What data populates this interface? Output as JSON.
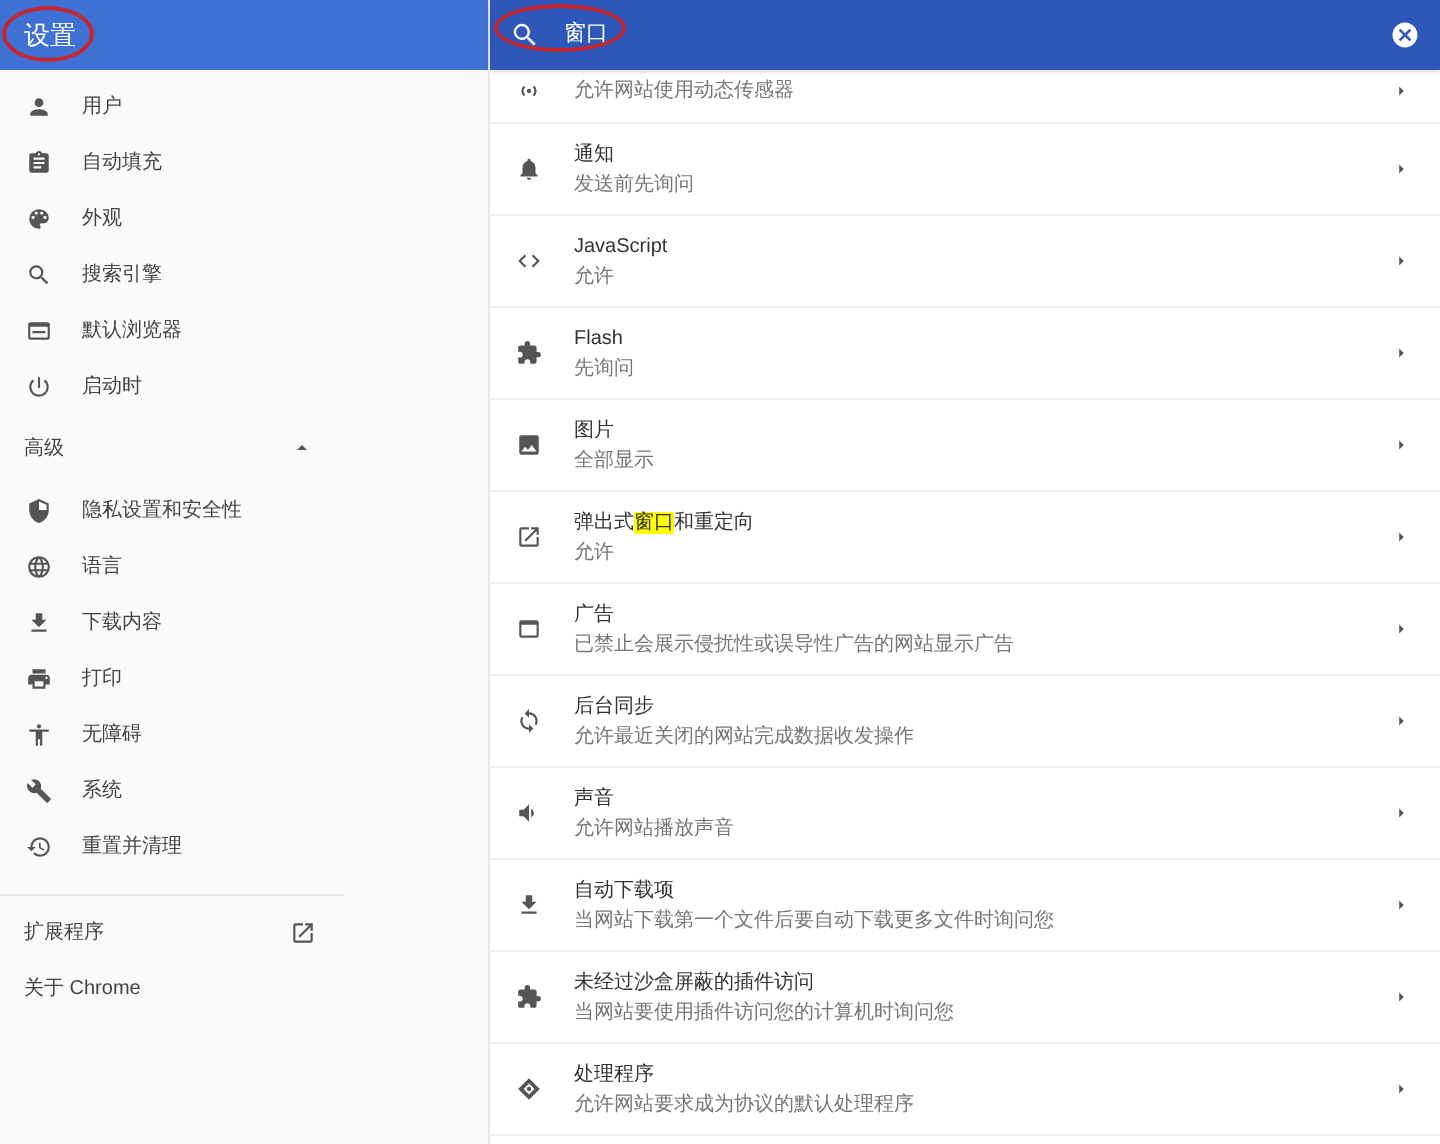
{
  "header": {
    "title": "设置",
    "title_circled": true,
    "search": {
      "value": "窗口",
      "circled": true
    }
  },
  "sidebar": {
    "items": [
      {
        "label": "用户"
      },
      {
        "label": "自动填充"
      },
      {
        "label": "外观"
      },
      {
        "label": "搜索引擎"
      },
      {
        "label": "默认浏览器"
      },
      {
        "label": "启动时"
      }
    ],
    "advanced": {
      "label": "高级",
      "expanded": true,
      "items": [
        {
          "label": "隐私设置和安全性"
        },
        {
          "label": "语言"
        },
        {
          "label": "下载内容"
        },
        {
          "label": "打印"
        },
        {
          "label": "无障碍"
        },
        {
          "label": "系统"
        },
        {
          "label": "重置并清理"
        }
      ]
    },
    "extensions": {
      "label": "扩展程序"
    },
    "about": {
      "label": "关于 Chrome"
    }
  },
  "content": {
    "rows": [
      {
        "subtitle": "允许网站使用动态传感器"
      },
      {
        "title": "通知",
        "subtitle": "发送前先询问"
      },
      {
        "title": "JavaScript",
        "subtitle": "允许"
      },
      {
        "title": "Flash",
        "subtitle": "先询问"
      },
      {
        "title": "图片",
        "subtitle": "全部显示"
      },
      {
        "title_segments": [
          {
            "text": "弹出式",
            "highlighted": false
          },
          {
            "text": "窗口",
            "highlighted": true
          },
          {
            "text": "和重定向",
            "highlighted": false
          }
        ],
        "subtitle": "允许"
      },
      {
        "title": "广告",
        "subtitle": "已禁止会展示侵扰性或误导性广告的网站显示广告"
      },
      {
        "title": "后台同步",
        "subtitle": "允许最近关闭的网站完成数据收发操作"
      },
      {
        "title": "声音",
        "subtitle": "允许网站播放声音"
      },
      {
        "title": "自动下载项",
        "subtitle": "当网站下载第一个文件后要自动下载更多文件时询问您"
      },
      {
        "title": "未经过沙盒屏蔽的插件访问",
        "subtitle": "当网站要使用插件访问您的计算机时询问您"
      },
      {
        "title": "处理程序",
        "subtitle": "允许网站要求成为协议的默认处理程序"
      }
    ]
  }
}
